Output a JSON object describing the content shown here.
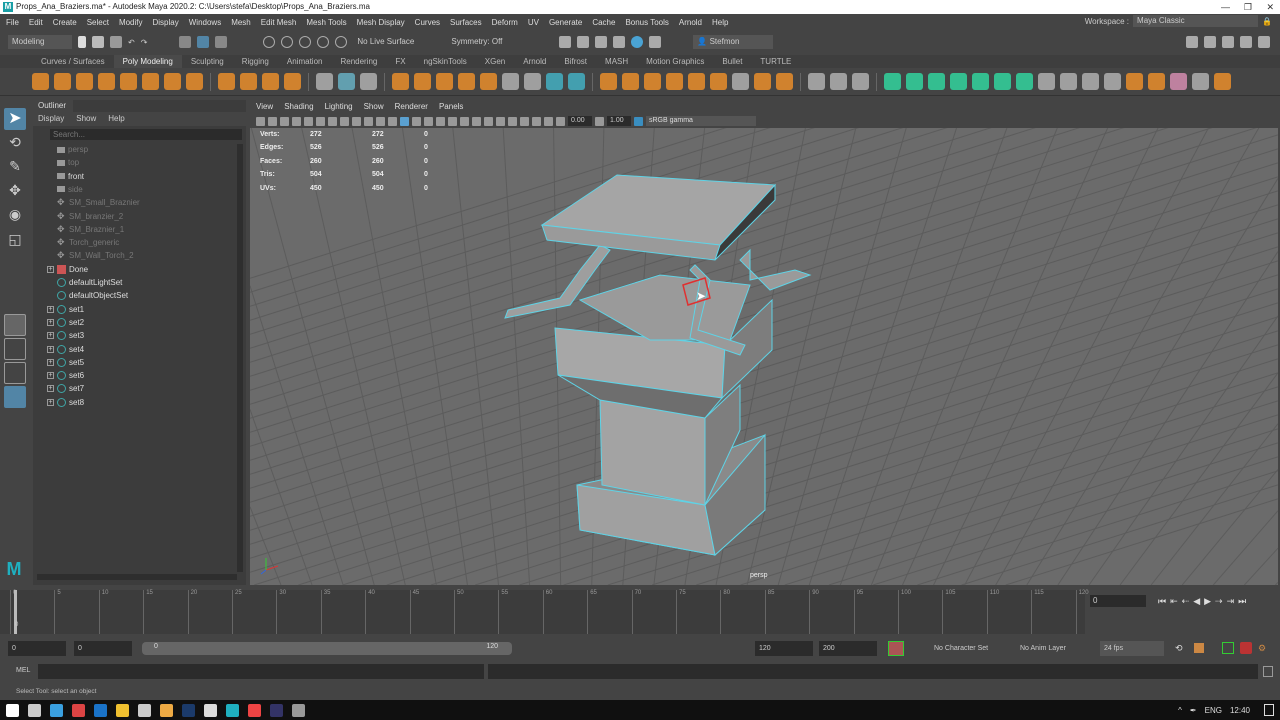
{
  "title": "Props_Ana_Braziers.ma* - Autodesk Maya 2020.2: C:\\Users\\stefa\\Desktop\\Props_Ana_Braziers.ma",
  "menus": [
    "File",
    "Edit",
    "Create",
    "Select",
    "Modify",
    "Display",
    "Windows",
    "Mesh",
    "Edit Mesh",
    "Mesh Tools",
    "Mesh Display",
    "Curves",
    "Surfaces",
    "Deform",
    "UV",
    "Generate",
    "Cache",
    "Bonus Tools",
    "Arnold",
    "Help"
  ],
  "workspace": {
    "label": "Workspace :",
    "value": "Maya Classic"
  },
  "statusline": {
    "mode": "Modeling",
    "live_surface": "No Live Surface",
    "symmetry": "Symmetry: Off",
    "user": "Stefmon"
  },
  "shelf_tabs": [
    "Curves / Surfaces",
    "Poly Modeling",
    "Sculpting",
    "Rigging",
    "Animation",
    "Rendering",
    "FX",
    "ngSkinTools",
    "XGen",
    "Arnold",
    "Bifrost",
    "MASH",
    "Motion Graphics",
    "Bullet",
    "TURTLE"
  ],
  "active_shelf_tab": "Poly Modeling",
  "outliner": {
    "title": "Outliner",
    "menu": [
      "Display",
      "Show",
      "Help"
    ],
    "search_placeholder": "Search...",
    "items": [
      {
        "label": "persp",
        "type": "cam",
        "dim": true
      },
      {
        "label": "top",
        "type": "cam",
        "dim": true
      },
      {
        "label": "front",
        "type": "cam",
        "dim": false
      },
      {
        "label": "side",
        "type": "cam",
        "dim": true
      },
      {
        "label": "SM_Small_Braznier",
        "type": "mesh",
        "dim": true
      },
      {
        "label": "SM_branzier_2",
        "type": "mesh",
        "dim": true
      },
      {
        "label": "SM_Braznier_1",
        "type": "mesh",
        "dim": true
      },
      {
        "label": "Torch_generic",
        "type": "mesh",
        "dim": true
      },
      {
        "label": "SM_Wall_Torch_2",
        "type": "mesh",
        "dim": true
      },
      {
        "label": "Done",
        "type": "layer",
        "dim": false,
        "expand": true
      },
      {
        "label": "defaultLightSet",
        "type": "set",
        "dim": false
      },
      {
        "label": "defaultObjectSet",
        "type": "set",
        "dim": false
      },
      {
        "label": "set1",
        "type": "set",
        "dim": false,
        "expand": true
      },
      {
        "label": "set2",
        "type": "set",
        "dim": false,
        "expand": true
      },
      {
        "label": "set3",
        "type": "set",
        "dim": false,
        "expand": true
      },
      {
        "label": "set4",
        "type": "set",
        "dim": false,
        "expand": true
      },
      {
        "label": "set5",
        "type": "set",
        "dim": false,
        "expand": true
      },
      {
        "label": "set6",
        "type": "set",
        "dim": false,
        "expand": true
      },
      {
        "label": "set7",
        "type": "set",
        "dim": false,
        "expand": true
      },
      {
        "label": "set8",
        "type": "set",
        "dim": false,
        "expand": true
      }
    ]
  },
  "viewport": {
    "menu": [
      "View",
      "Shading",
      "Lighting",
      "Show",
      "Renderer",
      "Panels"
    ],
    "exposure": "0.00",
    "gamma": "1.00",
    "color_space": "sRGB gamma",
    "camera": "persp",
    "hud": [
      {
        "label": "Verts:",
        "a": "272",
        "b": "272",
        "c": "0"
      },
      {
        "label": "Edges:",
        "a": "526",
        "b": "526",
        "c": "0"
      },
      {
        "label": "Faces:",
        "a": "260",
        "b": "260",
        "c": "0"
      },
      {
        "label": "Tris:",
        "a": "504",
        "b": "504",
        "c": "0"
      },
      {
        "label": "UVs:",
        "a": "450",
        "b": "450",
        "c": "0"
      }
    ]
  },
  "timeline": {
    "ticks": [
      "0",
      "5",
      "10",
      "15",
      "20",
      "25",
      "30",
      "35",
      "40",
      "45",
      "50",
      "55",
      "60",
      "65",
      "70",
      "75",
      "80",
      "85",
      "90",
      "95",
      "100",
      "105",
      "110",
      "115",
      "120"
    ],
    "current_frame": "0",
    "playhead": "0"
  },
  "range": {
    "start": "0",
    "anim_start": "0",
    "slider_start": "0",
    "slider_end": "120",
    "end": "120",
    "anim_end": "200",
    "character_set": "No Character Set",
    "anim_layer": "No Anim Layer",
    "fps": "24 fps"
  },
  "mel": {
    "label": "MEL"
  },
  "help_line": "Select Tool: select an object",
  "tray": {
    "lang": "ENG",
    "time": "12:40"
  },
  "colors": {
    "accent": "#5285a6",
    "wire": "#5fd3e6",
    "selected_face": "#e03030"
  }
}
